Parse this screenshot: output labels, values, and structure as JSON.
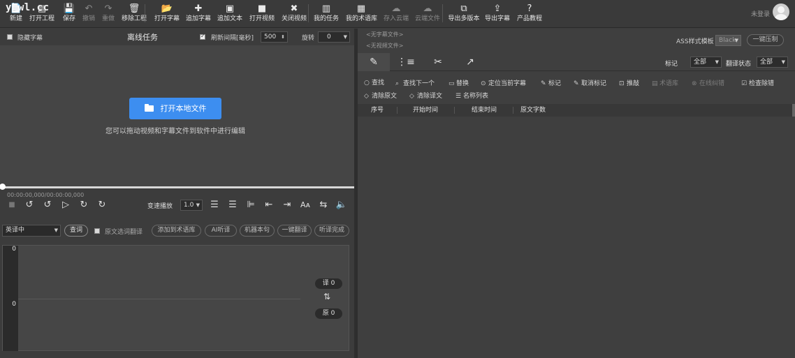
{
  "app": {
    "logo": "ybwl.cc",
    "login_text": "未登录"
  },
  "toolbar": [
    {
      "label": "新建",
      "icon": "new-file-icon",
      "glyph": "📄",
      "enabled": true
    },
    {
      "label": "打开工程",
      "icon": "open-project-icon",
      "glyph": "▤",
      "enabled": true
    },
    {
      "label": "保存",
      "icon": "save-icon",
      "glyph": "💾",
      "enabled": true
    },
    {
      "label": "撤销",
      "icon": "undo-icon",
      "glyph": "↶",
      "enabled": false
    },
    {
      "label": "重做",
      "icon": "redo-icon",
      "glyph": "↷",
      "enabled": false
    },
    {
      "label": "移除工程",
      "icon": "trash-icon",
      "glyph": "🗑",
      "enabled": true
    },
    {
      "label": "打开字幕",
      "icon": "folder-icon",
      "glyph": "📂",
      "enabled": true
    },
    {
      "label": "追加字幕",
      "icon": "plus-icon",
      "glyph": "✚",
      "enabled": true
    },
    {
      "label": "追加文本",
      "icon": "text-doc-icon",
      "glyph": "▣",
      "enabled": true
    },
    {
      "label": "打开视频",
      "icon": "video-camera-icon",
      "glyph": "■",
      "enabled": true
    },
    {
      "label": "关闭视频",
      "icon": "close-video-icon",
      "glyph": "✖",
      "enabled": true
    },
    {
      "label": "我的任务",
      "icon": "clipboard-icon",
      "glyph": "▥",
      "enabled": true
    },
    {
      "label": "我的术语库",
      "icon": "book-icon",
      "glyph": "▦",
      "enabled": true
    },
    {
      "label": "存入云端",
      "icon": "cloud-upload-icon",
      "glyph": "☁",
      "enabled": false
    },
    {
      "label": "云端文件",
      "icon": "cloud-icon",
      "glyph": "☁",
      "enabled": false
    },
    {
      "label": "导出多版本",
      "icon": "layers-export-icon",
      "glyph": "⧉",
      "enabled": true
    },
    {
      "label": "导出字幕",
      "icon": "export-icon",
      "glyph": "⇪",
      "enabled": true
    },
    {
      "label": "产品教程",
      "icon": "help-icon",
      "glyph": "?",
      "enabled": true
    }
  ],
  "left": {
    "hide_subtitles_label": "隐藏字幕",
    "title": "离线任务",
    "refresh_label": "刷新间隔[毫秒]",
    "refresh_value": "500",
    "rotate_label": "旋转",
    "rotate_value": "0",
    "open_local_label": "打开本地文件",
    "drop_hint": "您可以拖动视频和字幕文件到软件中进行编辑",
    "timecode": "00:00:00,000/00:00:00,000",
    "speed_label": "变速播放",
    "speed_value": "1.0",
    "translate_mode": "英译中",
    "lookup_label": "查词",
    "original_select_label": "原文选词翻译",
    "actions": [
      "添加到术语库",
      "AI听译",
      "机器本句",
      "一键翻译",
      "听译完成"
    ],
    "wave_top": "0",
    "wave_bottom": "0",
    "trans_count": "译 0",
    "orig_count": "原 0"
  },
  "right": {
    "no_subtitle_file": "<无字幕文件>",
    "no_video_file": "<无视频文件>",
    "ass_template_label": "ASS样式模板",
    "ass_template_value": "Black",
    "compress_label": "一键压制",
    "mark_label": "标记",
    "mark_value": "全部",
    "trans_status_label": "翻译状态",
    "trans_status_value": "全部",
    "tools": [
      {
        "label": "查找",
        "icon": "search-icon",
        "glyph": "○",
        "enabled": true
      },
      {
        "label": "查找下一个",
        "icon": "find-next-icon",
        "glyph": "⌕",
        "enabled": true
      },
      {
        "label": "替换",
        "icon": "replace-icon",
        "glyph": "▭",
        "enabled": true
      },
      {
        "label": "定位当前字幕",
        "icon": "location-pin-icon",
        "glyph": "⊙",
        "enabled": true
      },
      {
        "label": "标记",
        "icon": "pin-icon",
        "glyph": "✎",
        "enabled": true
      },
      {
        "label": "取消标记",
        "icon": "unpin-icon",
        "glyph": "✎",
        "enabled": true
      },
      {
        "label": "推敲",
        "icon": "refine-icon",
        "glyph": "⊡",
        "enabled": true
      },
      {
        "label": "术语库",
        "icon": "glossary-icon",
        "glyph": "▤",
        "enabled": false
      },
      {
        "label": "在线纠错",
        "icon": "online-check-icon",
        "glyph": "⊗",
        "enabled": false
      },
      {
        "label": "检查除错",
        "icon": "check-box-icon",
        "glyph": "☑",
        "enabled": true
      },
      {
        "label": "清除原文",
        "icon": "eraser-icon",
        "glyph": "◇",
        "enabled": true
      },
      {
        "label": "清除译文",
        "icon": "eraser-icon",
        "glyph": "◇",
        "enabled": true
      },
      {
        "label": "名称列表",
        "icon": "list-icon",
        "glyph": "☰",
        "enabled": true
      }
    ],
    "table_headers": [
      "序号",
      "开始时间",
      "结束时间",
      "原文字数"
    ]
  },
  "colors": {
    "accent": "#3d8ef0",
    "background": "#3c3c3c"
  }
}
